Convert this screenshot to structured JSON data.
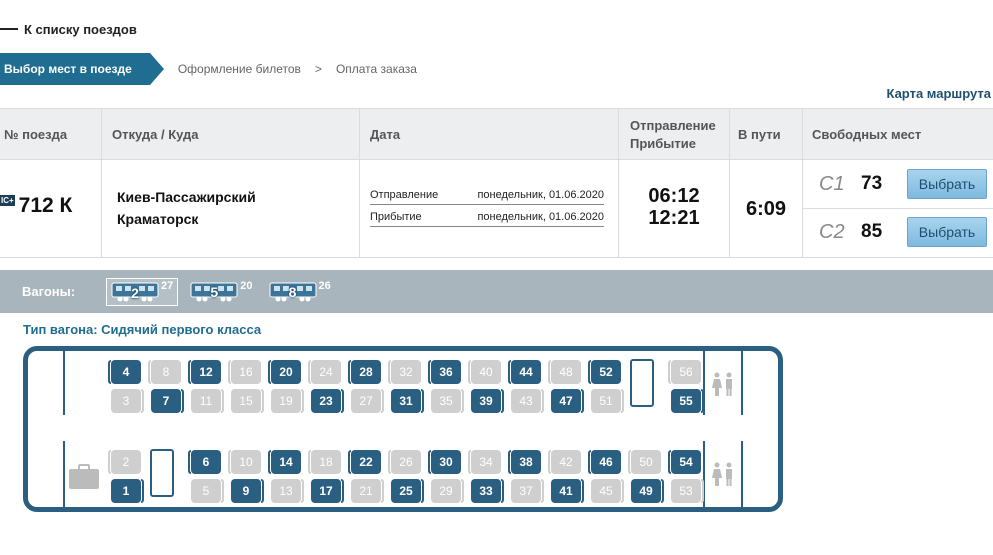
{
  "nav": {
    "back_label": "К списку поездов"
  },
  "steps": {
    "active": "Выбор мест в поезде",
    "second": "Оформление билетов",
    "sep": ">",
    "third": "Оплата заказа"
  },
  "route_map_link": "Карта маршрута",
  "table": {
    "headers": {
      "train_no": "№ поезда",
      "route": "Откуда / Куда",
      "date": "Дата",
      "dep_arr_1": "Отправление",
      "dep_arr_2": "Прибытие",
      "travel": "В пути",
      "free": "Свободных мест"
    },
    "row": {
      "badge": "IC+",
      "train_number": "712 К",
      "from": "Киев-Пассажирский",
      "to": "Краматорск",
      "dep_label": "Отправление",
      "dep_date": "понедельник, 01.06.2020",
      "arr_label": "Прибытие",
      "arr_date": "понедельник, 01.06.2020",
      "dep_time": "06:12",
      "arr_time": "12:21",
      "travel_time": "6:09",
      "classes": [
        {
          "name": "С1",
          "free": "73",
          "button": "Выбрать"
        },
        {
          "name": "С2",
          "free": "85",
          "button": "Выбрать"
        }
      ]
    }
  },
  "wagons": {
    "label": "Вагоны:",
    "items": [
      {
        "number": "2",
        "free": "27",
        "active": true
      },
      {
        "number": "5",
        "free": "20",
        "active": false
      },
      {
        "number": "8",
        "free": "26",
        "active": false
      }
    ]
  },
  "car_type": "Тип вагона: Сидячий первого класса",
  "seats": {
    "row_top": [
      {
        "n": "4",
        "free": true
      },
      {
        "n": "8",
        "free": false
      },
      {
        "n": "12",
        "free": true
      },
      {
        "n": "16",
        "free": false
      },
      {
        "n": "20",
        "free": true
      },
      {
        "n": "24",
        "free": false
      },
      {
        "n": "28",
        "free": true
      },
      {
        "n": "32",
        "free": false
      },
      {
        "n": "36",
        "free": true
      },
      {
        "n": "40",
        "free": false
      },
      {
        "n": "44",
        "free": true
      },
      {
        "n": "48",
        "free": false
      },
      {
        "n": "52",
        "free": true
      },
      {
        "n": "56",
        "free": false
      }
    ],
    "row_2": [
      {
        "n": "3",
        "free": false
      },
      {
        "n": "7",
        "free": true
      },
      {
        "n": "11",
        "free": false
      },
      {
        "n": "15",
        "free": false
      },
      {
        "n": "19",
        "free": false
      },
      {
        "n": "23",
        "free": true
      },
      {
        "n": "27",
        "free": false
      },
      {
        "n": "31",
        "free": true
      },
      {
        "n": "35",
        "free": false
      },
      {
        "n": "39",
        "free": true
      },
      {
        "n": "43",
        "free": false
      },
      {
        "n": "47",
        "free": true
      },
      {
        "n": "51",
        "free": false
      },
      {
        "n": "55",
        "free": true
      }
    ],
    "row_3": [
      {
        "n": "2",
        "free": false
      },
      {
        "n": "6",
        "free": true
      },
      {
        "n": "10",
        "free": false
      },
      {
        "n": "14",
        "free": true
      },
      {
        "n": "18",
        "free": false
      },
      {
        "n": "22",
        "free": true
      },
      {
        "n": "26",
        "free": false
      },
      {
        "n": "30",
        "free": true
      },
      {
        "n": "34",
        "free": false
      },
      {
        "n": "38",
        "free": true
      },
      {
        "n": "42",
        "free": false
      },
      {
        "n": "46",
        "free": true
      },
      {
        "n": "50",
        "free": false
      },
      {
        "n": "54",
        "free": true
      }
    ],
    "row_bottom": [
      {
        "n": "1",
        "free": true
      },
      {
        "n": "5",
        "free": false
      },
      {
        "n": "9",
        "free": true
      },
      {
        "n": "13",
        "free": false
      },
      {
        "n": "17",
        "free": true
      },
      {
        "n": "21",
        "free": false
      },
      {
        "n": "25",
        "free": true
      },
      {
        "n": "29",
        "free": false
      },
      {
        "n": "33",
        "free": true
      },
      {
        "n": "37",
        "free": false
      },
      {
        "n": "41",
        "free": true
      },
      {
        "n": "45",
        "free": false
      },
      {
        "n": "49",
        "free": true
      },
      {
        "n": "53",
        "free": false
      }
    ]
  },
  "colors": {
    "accent": "#1f6d90",
    "seat_free": "#2b5f82",
    "seat_busy": "#cfcfcf",
    "wagon_bar": "#a8b5bc"
  }
}
